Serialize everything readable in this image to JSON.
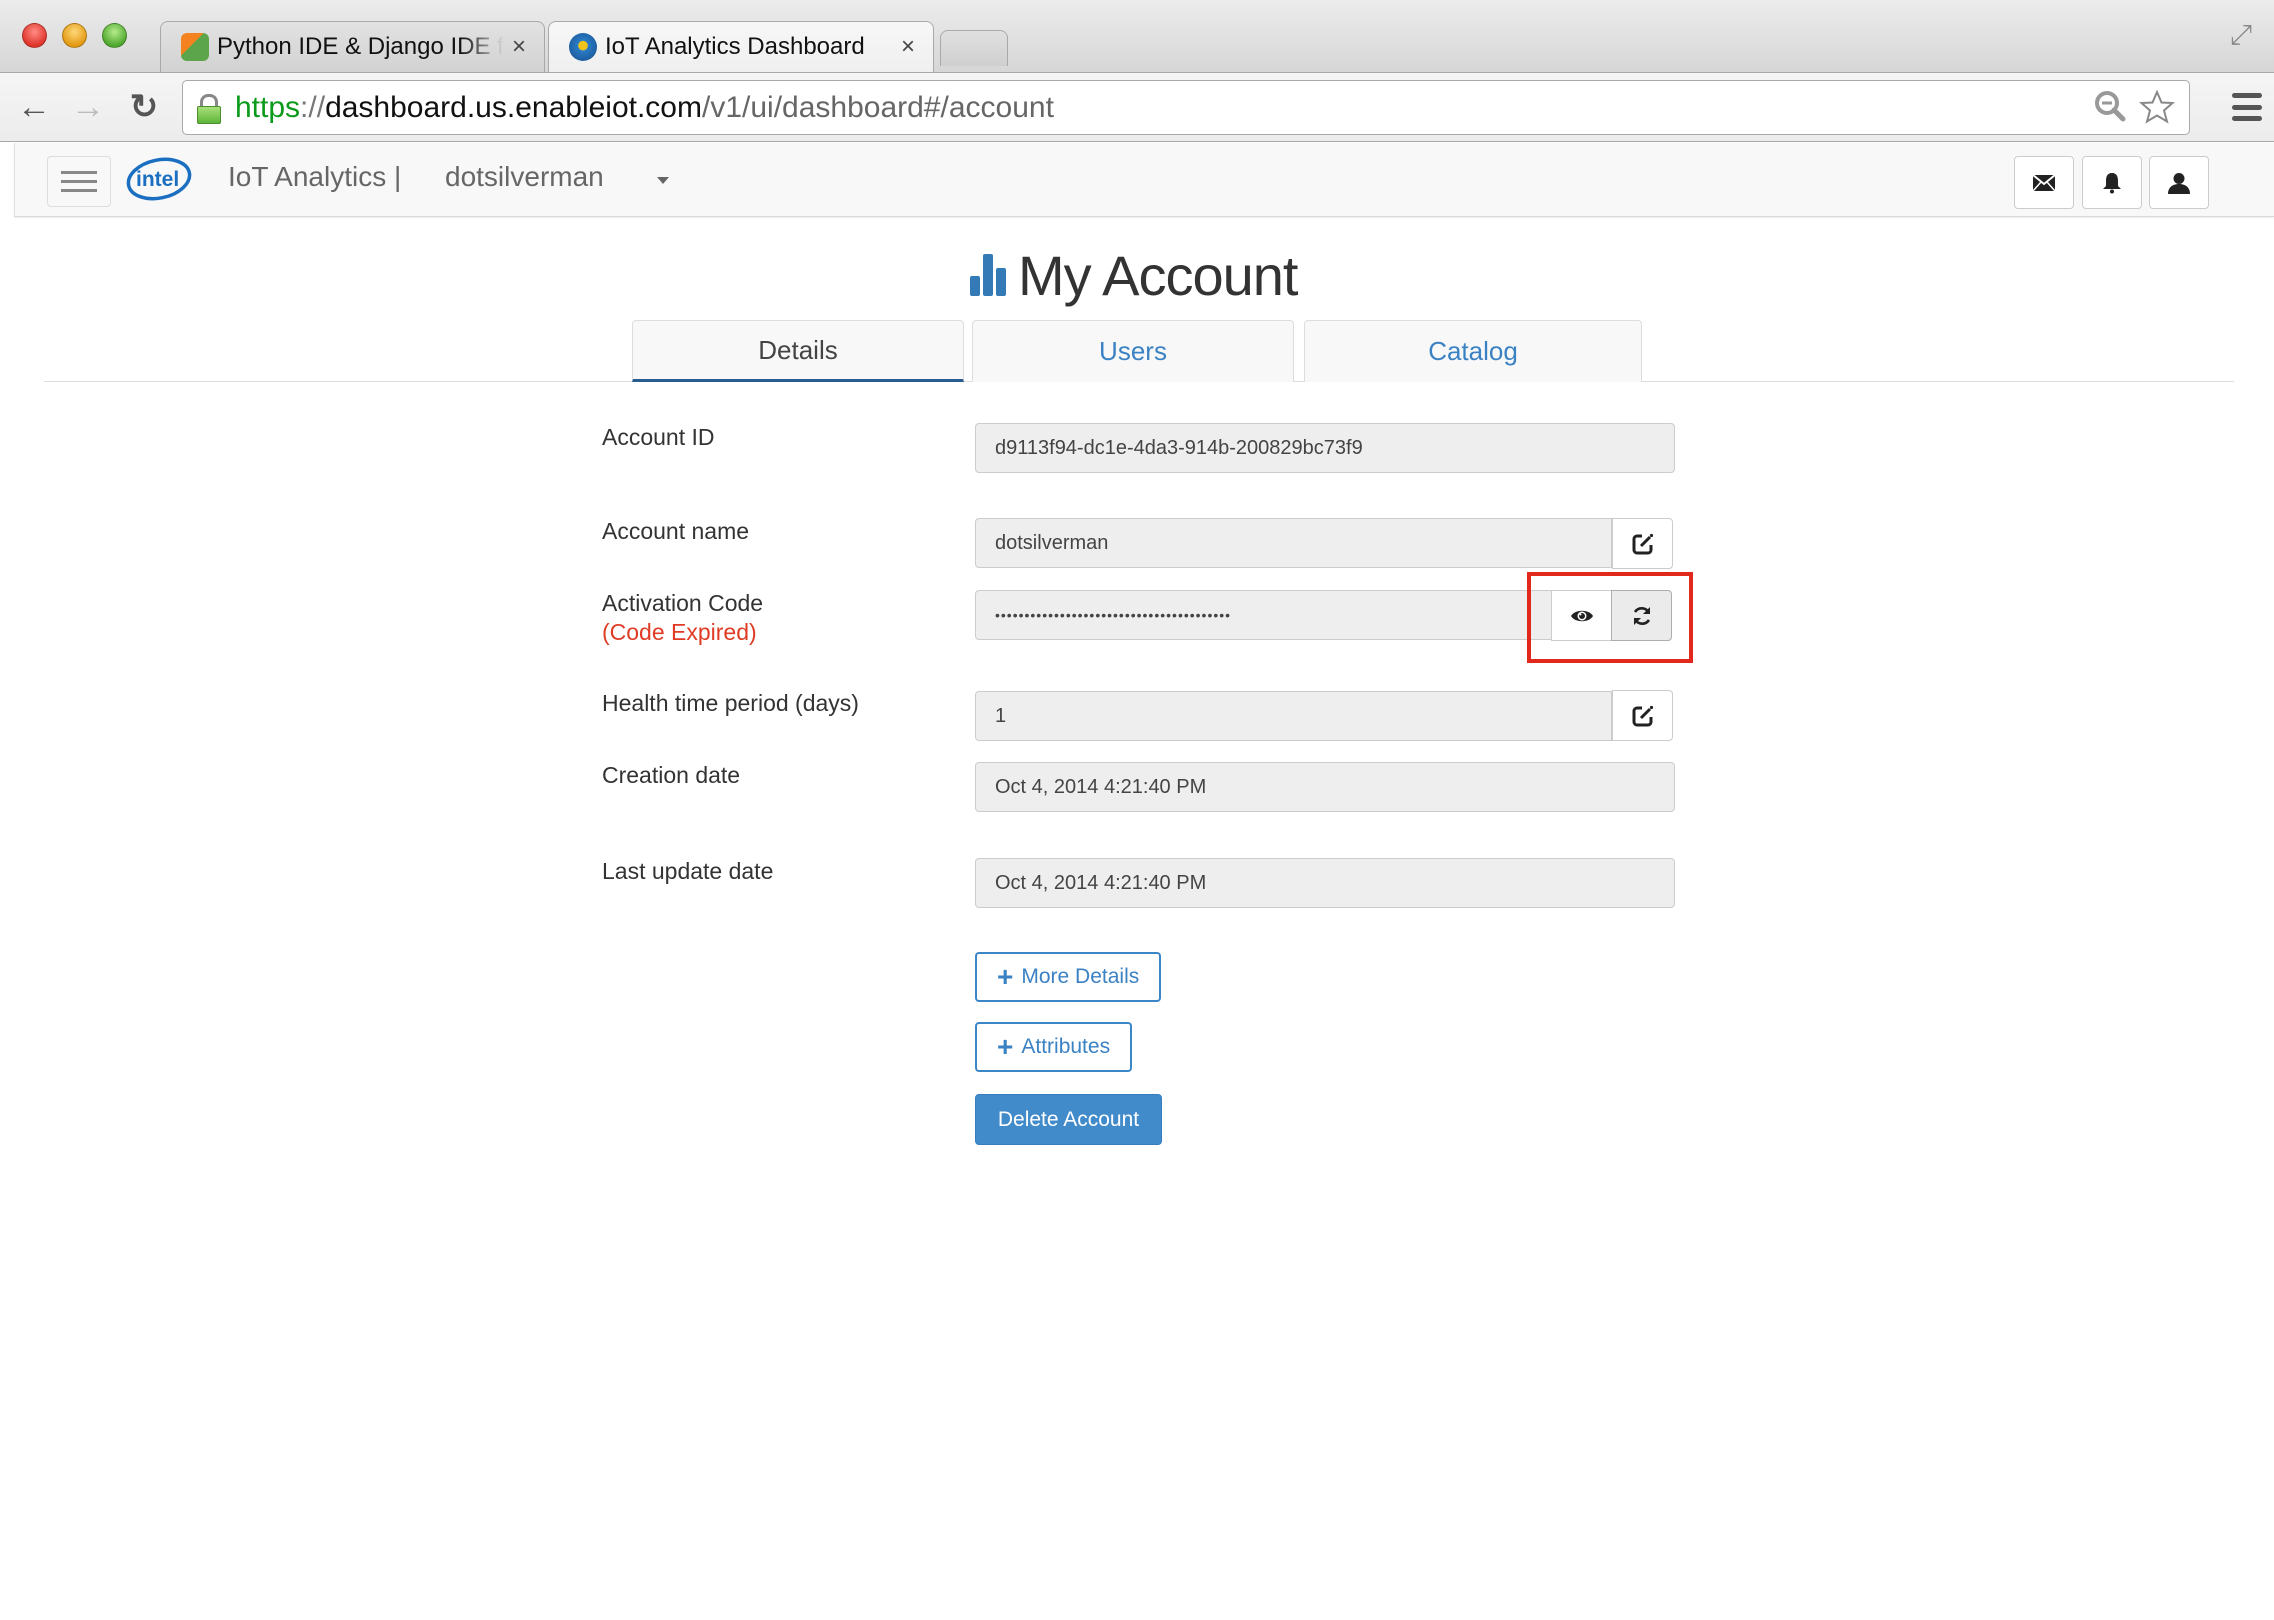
{
  "browser": {
    "tabs": [
      {
        "title": "Python IDE & Django IDE for Web developers",
        "icon": "pycharm-icon",
        "active": false
      },
      {
        "title": "IoT Analytics Dashboard",
        "icon": "iot-analytics-icon",
        "active": true
      }
    ],
    "close_glyph": "×",
    "url": {
      "scheme": "https",
      "separator": "://",
      "host": "dashboard.us.enableiot.com",
      "path": "/v1/ui/dashboard#/account"
    },
    "nav": {
      "back": "←",
      "forward": "→",
      "reload": "↻"
    },
    "fullscreen_glyph": "⤢",
    "zoom_glyph": "🔍",
    "bookmark_glyph": "☆"
  },
  "header": {
    "logo_text": "intel",
    "brand": "IoT Analytics |",
    "account": "dotsilverman"
  },
  "page": {
    "title": "My Account",
    "tabs": [
      {
        "label": "Details",
        "active": true
      },
      {
        "label": "Users",
        "active": false
      },
      {
        "label": "Catalog",
        "active": false
      }
    ]
  },
  "form": {
    "account_id": {
      "label": "Account ID",
      "value": "d9113f94-dc1e-4da3-914b-200829bc73f9"
    },
    "account_name": {
      "label": "Account name",
      "value": "dotsilverman"
    },
    "activation_code": {
      "label": "Activation Code",
      "status": "(Code Expired)",
      "value": "••••••••••••••••••••••••••••••••••••••••"
    },
    "health_period": {
      "label": "Health time period (days)",
      "value": "1"
    },
    "creation_date": {
      "label": "Creation date",
      "value": "Oct 4, 2014 4:21:40 PM"
    },
    "last_update_date": {
      "label": "Last update date",
      "value": "Oct 4, 2014 4:21:40 PM"
    }
  },
  "actions": {
    "more_details": "More Details",
    "attributes": "Attributes",
    "delete_account": "Delete Account",
    "plus_glyph": "+"
  },
  "colors": {
    "accent": "#428bca",
    "link": "#3b82c4",
    "expired": "#e03b24",
    "highlight": "#e0291c"
  }
}
